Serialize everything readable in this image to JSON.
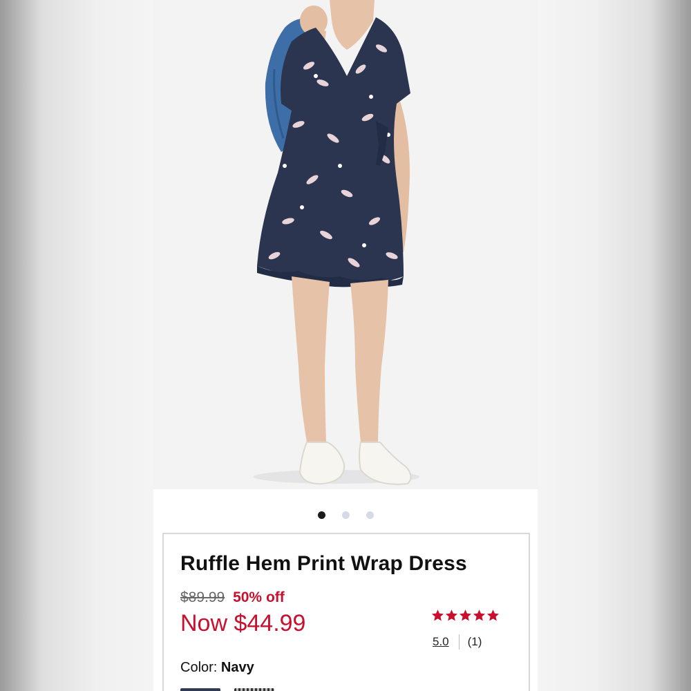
{
  "product": {
    "title": "Ruffle Hem Print Wrap Dress",
    "original_price": "$89.99",
    "discount": "50% off",
    "sale_price": "Now $44.99",
    "rating_value": "5.0",
    "review_count": "(1)",
    "stars_filled": 5,
    "stars_total": 5,
    "color_label": "Color:",
    "color_value": "Navy"
  },
  "gallery": {
    "image_count": 3,
    "active_index": 0
  },
  "colors": {
    "accent": "#c8102e",
    "dress": "#2b3550"
  }
}
